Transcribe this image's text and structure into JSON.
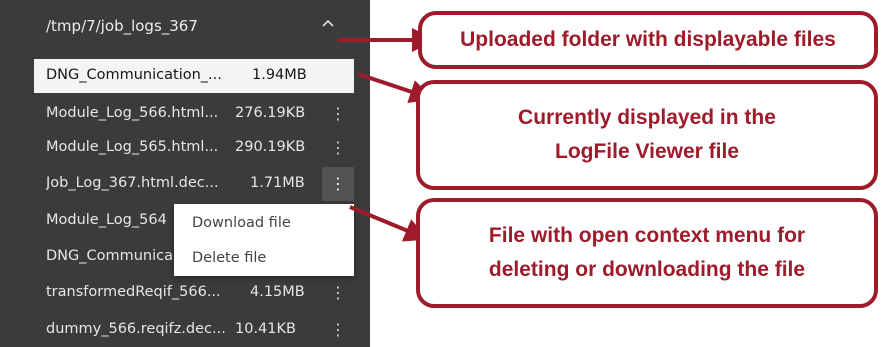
{
  "sidebar": {
    "folder_path": "/tmp/7/job_logs_367",
    "files": [
      {
        "name": "DNG_Communication_...",
        "size": "1.94MB",
        "selected": true
      },
      {
        "name": "Module_Log_566.html...",
        "size": "276.19KB"
      },
      {
        "name": "Module_Log_565.html...",
        "size": "290.19KB"
      },
      {
        "name": "Job_Log_367.html.dec...",
        "size": "1.71MB"
      },
      {
        "name": "Module_Log_564",
        "size": ""
      },
      {
        "name": "DNG_Communica",
        "size": ""
      },
      {
        "name": "transformedReqif_566...",
        "size": "4.15MB"
      },
      {
        "name": "dummy_566.reqifz.dec...",
        "size": "10.41KB"
      }
    ]
  },
  "context_menu": {
    "download_label": "Download file",
    "delete_label": "Delete file"
  },
  "callouts": {
    "folder": "Uploaded folder with displayable files",
    "current": "Currently displayed in the LogFile Viewer file",
    "context": "File with open context menu for deleting or downloading the file"
  },
  "colors": {
    "panel_bg": "#3b3b3b",
    "selected_row_bg": "#f4f4f4",
    "callout_accent": "#9d1b2a"
  }
}
